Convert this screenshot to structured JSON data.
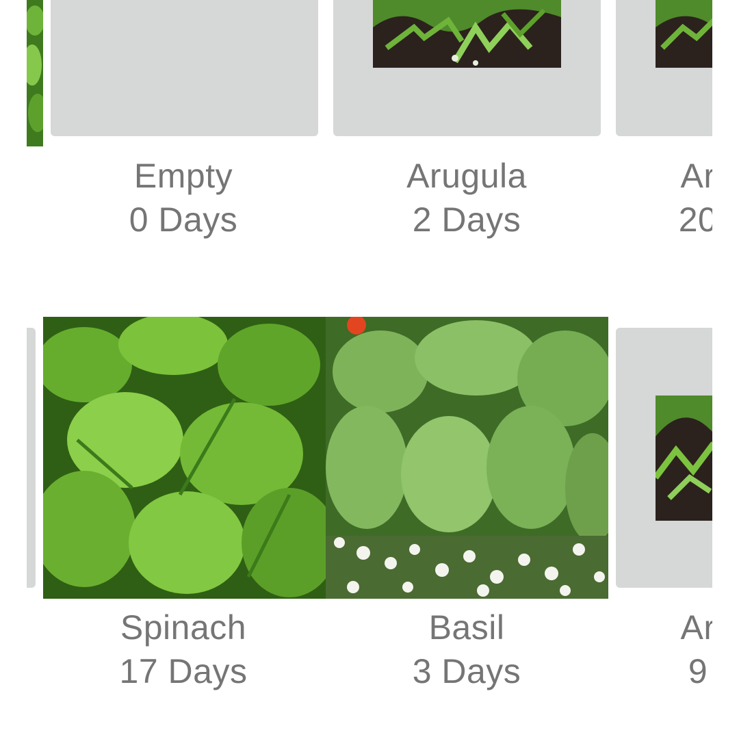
{
  "plants": [
    {
      "name": "Empty",
      "days": "0 Days",
      "image": "empty-slot"
    },
    {
      "name": "Arugula",
      "days": "2 Days",
      "image": "arugula-photo"
    },
    {
      "name": "Ar",
      "days": "20",
      "image": "arugula-photo"
    },
    {
      "name": "Spinach",
      "days": "17 Days",
      "image": "spinach-photo"
    },
    {
      "name": "Basil",
      "days": "3 Days",
      "image": "basil-photo"
    },
    {
      "name": "Ar",
      "days": "9",
      "image": "arugula-photo"
    }
  ],
  "colors": {
    "tile_bg": "#d6d7d7",
    "label_text": "#757575",
    "page_bg": "#ffffff"
  }
}
